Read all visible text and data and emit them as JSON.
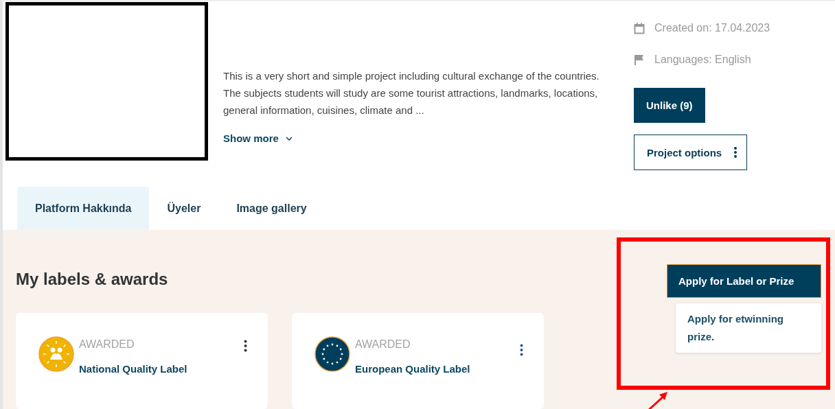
{
  "project": {
    "description": "This is a very short and simple project including cultural exchange of the countries. The subjects students will study are some tourist attractions, landmarks, locations, general information, cuisines, climate and ...",
    "show_more": "Show more"
  },
  "meta": [
    {
      "kind": "date",
      "text": "Created on: 17.04.2023"
    },
    {
      "kind": "language",
      "text": "Languages: English"
    }
  ],
  "like_button": {
    "label": "Unlike (9)"
  },
  "options_button": {
    "label": "Project options"
  },
  "tabs": [
    {
      "label": "Platform Hakkında",
      "selected": true
    },
    {
      "label": "Üyeler",
      "selected": false
    },
    {
      "label": "Image gallery",
      "selected": false
    }
  ],
  "awards": {
    "title": "My labels & awards",
    "apply_button": "Apply for Label or Prize",
    "menu": [
      "Apply for etwinning prize."
    ],
    "cards": [
      {
        "kind": "national",
        "status": "AWARDED",
        "title": "National Quality Label"
      },
      {
        "kind": "european",
        "status": "AWARDED",
        "title": "European Quality Label"
      }
    ]
  }
}
